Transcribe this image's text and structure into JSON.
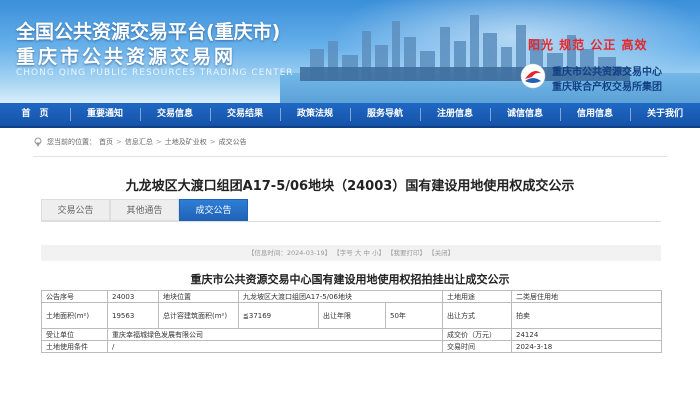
{
  "banner": {
    "title_line1": "全国公共资源交易平台(重庆市)",
    "title_line2": "重庆市公共资源交易网",
    "title_en": "CHONG QING PUBLIC RESOURCES TRADING CENTER",
    "slogan": "阳光 规范 公正 高效",
    "group_line1": "重庆市公共资源交易中心",
    "group_line2": "重庆联合产权交易所集团",
    "colors": {
      "slogan": "#e8262a",
      "group_text": "#123f84",
      "nav": "#1f68c4"
    }
  },
  "nav": {
    "items": [
      "首　页",
      "重要通知",
      "交易信息",
      "交易结果",
      "政策法规",
      "服务导航",
      "注册信息",
      "诚信信息",
      "信用信息",
      "关于我们"
    ]
  },
  "breadcrumb": {
    "prefix": "您当前的位置：",
    "items": [
      "首页",
      "信息汇总",
      "土地及矿业权",
      "成交公告"
    ],
    "separator": ">"
  },
  "page": {
    "title": "九龙坡区大渡口组团A17-5/06地块（24003）国有建设用地使用权成交公示",
    "tabs": [
      {
        "label": "交易公告",
        "active": false
      },
      {
        "label": "其他通告",
        "active": false
      },
      {
        "label": "成交公告",
        "active": true
      }
    ],
    "info": {
      "date": "【信息时间：2024-03-19】",
      "font_size": "【字号 大 中 小】",
      "print": "【我要打印】",
      "close": "【关闭】"
    },
    "notice_title": "重庆市公共资源交易中心国有建设用地使用权招拍挂出让成交公示"
  },
  "table": {
    "row1": {
      "c1": "公告序号",
      "c2": "24003",
      "c3": "地块位置",
      "c4": "九龙坡区大渡口组团A17-5/06地块",
      "c5": "土地用途",
      "c6": "二类居住用地"
    },
    "row2": {
      "c1": "土地面积(m²)",
      "c2": "19563",
      "c3": "总计容建筑面积(m²)",
      "c4": "≦37169",
      "c5": "出让年限",
      "c6": "50年",
      "c7": "出让方式",
      "c8": "拍卖"
    },
    "row3": {
      "c1": "受让单位",
      "c2": "重庆幸福城绿色发展有限公司",
      "c3": "成交价（万元）",
      "c4": "24124"
    },
    "row4": {
      "c1": "土地使用条件",
      "c2": "/",
      "c3": "交易时间",
      "c4": "2024-3-18"
    }
  }
}
